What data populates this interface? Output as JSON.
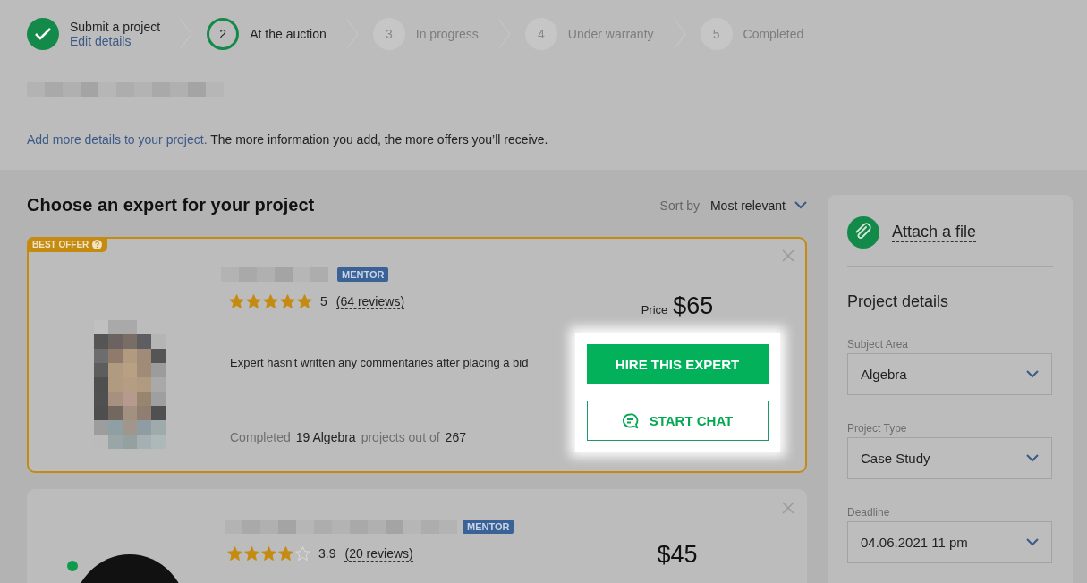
{
  "steps": [
    {
      "number": "2",
      "label": "At the auction",
      "current": true
    },
    {
      "number": "3",
      "label": "In progress",
      "current": false
    },
    {
      "number": "4",
      "label": "Under warranty",
      "current": false
    },
    {
      "number": "5",
      "label": "Completed",
      "current": false
    }
  ],
  "first_step": {
    "label": "Submit a project",
    "link": "Edit details",
    "done": true
  },
  "project_hint": {
    "link": "Add more details to your project.",
    "text": "The more information you add, the more offers you’ll receive."
  },
  "experts": {
    "title": "Choose an expert for your project",
    "sort_label": "Sort by",
    "sort_value": "Most relevant",
    "offers": [
      {
        "best_offer": true,
        "badge": "BEST OFFER",
        "online": false,
        "has_photo": true,
        "tag": "MENTOR",
        "stars": 5,
        "rating": "5",
        "reviews": "(64 reviews)",
        "comment": "Expert hasn't written any commentaries after placing a bid",
        "completed": [
          "Completed",
          "19 Algebra",
          "projects out of",
          "267"
        ],
        "price_label": "Price",
        "price": "$65",
        "hire": "HIRE THIS EXPERT",
        "chat": "START CHAT"
      },
      {
        "best_offer": false,
        "online": true,
        "has_photo": false,
        "tag": "MENTOR",
        "stars": 4,
        "rating": "3.9",
        "reviews": "(20 reviews)",
        "price": "$45"
      }
    ]
  },
  "sidebar": {
    "attach": "Attach a file",
    "title": "Project details",
    "fields": [
      {
        "label": "Subject Area",
        "value": "Algebra"
      },
      {
        "label": "Project Type",
        "value": "Case Study"
      },
      {
        "label": "Deadline",
        "value": "04.06.2021 11 pm"
      }
    ]
  }
}
